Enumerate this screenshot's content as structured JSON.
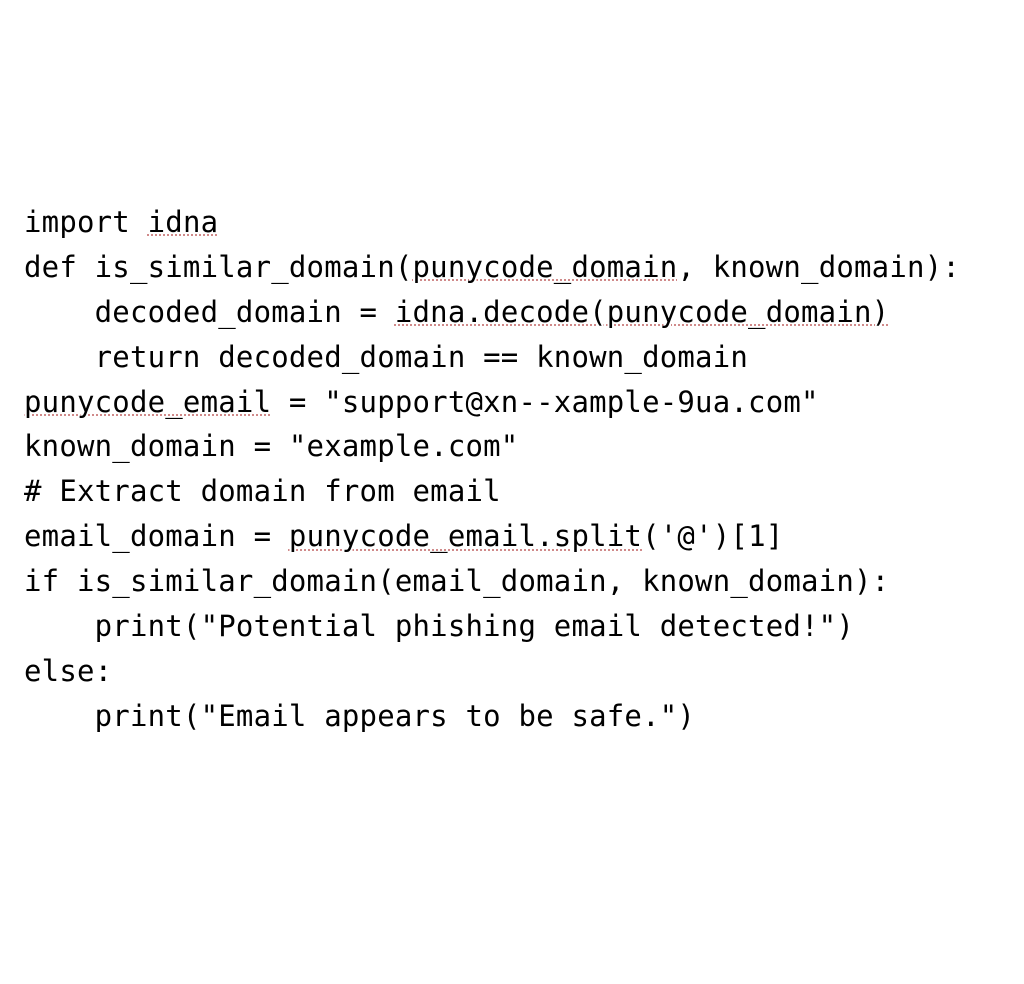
{
  "code": {
    "lines": [
      {
        "segments": [
          {
            "text": "import ",
            "u": false
          },
          {
            "text": "idna",
            "u": true
          }
        ]
      },
      {
        "segments": [
          {
            "text": "",
            "u": false
          }
        ]
      },
      {
        "segments": [
          {
            "text": "def is_similar_domain(",
            "u": false
          },
          {
            "text": "punycode_domain",
            "u": true
          },
          {
            "text": ", known_domain):",
            "u": false
          }
        ]
      },
      {
        "segments": [
          {
            "text": "    decoded_domain = ",
            "u": false
          },
          {
            "text": "idna.decode(punycode_domain)",
            "u": true
          }
        ]
      },
      {
        "segments": [
          {
            "text": "    return decoded_domain == known_domain",
            "u": false
          }
        ]
      },
      {
        "segments": [
          {
            "text": "",
            "u": false
          }
        ]
      },
      {
        "segments": [
          {
            "text": "punycode_email",
            "u": true
          },
          {
            "text": " = \"support@xn--xample-9ua.com\"",
            "u": false
          }
        ]
      },
      {
        "segments": [
          {
            "text": "known_domain = \"example.com\"",
            "u": false
          }
        ]
      },
      {
        "segments": [
          {
            "text": "",
            "u": false
          }
        ]
      },
      {
        "segments": [
          {
            "text": "# Extract domain from email",
            "u": false
          }
        ]
      },
      {
        "segments": [
          {
            "text": "email_domain = ",
            "u": false
          },
          {
            "text": "punycode_email.split",
            "u": true
          },
          {
            "text": "('@')[1]",
            "u": false
          }
        ]
      },
      {
        "segments": [
          {
            "text": "",
            "u": false
          }
        ]
      },
      {
        "segments": [
          {
            "text": "if is_similar_domain(email_domain, known_domain):",
            "u": false
          }
        ]
      },
      {
        "segments": [
          {
            "text": "    print(\"Potential phishing email detected!\")",
            "u": false
          }
        ]
      },
      {
        "segments": [
          {
            "text": "else:",
            "u": false
          }
        ]
      },
      {
        "segments": [
          {
            "text": "    print(\"Email appears to be safe.\")",
            "u": false
          }
        ]
      }
    ]
  }
}
